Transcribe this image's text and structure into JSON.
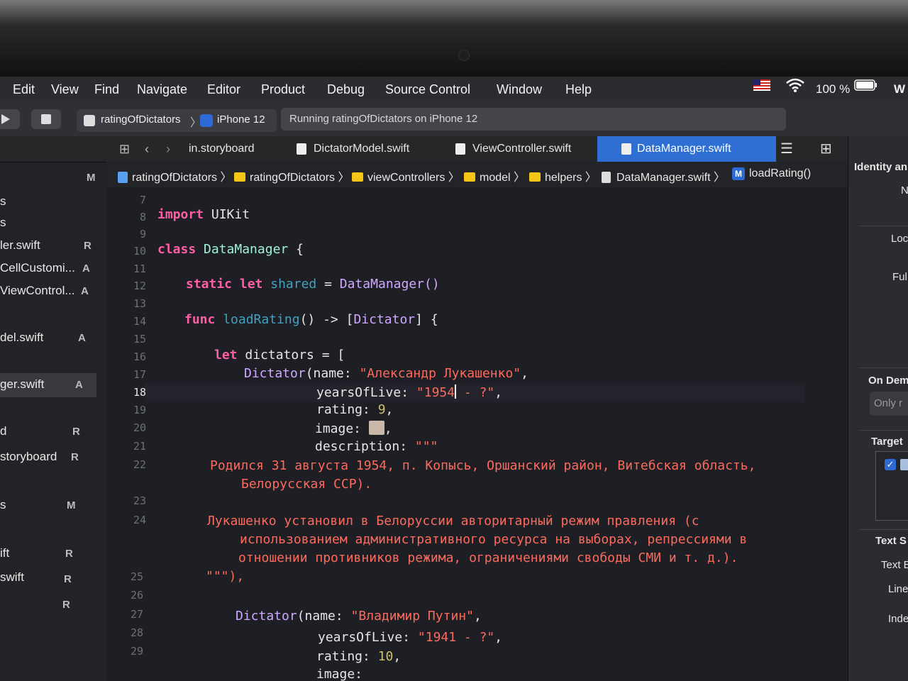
{
  "menu": {
    "items": [
      "Edit",
      "View",
      "Find",
      "Navigate",
      "Editor",
      "Product",
      "Debug",
      "Source Control",
      "Window",
      "Help"
    ],
    "battery": "100 %",
    "trailing": "W"
  },
  "toolbar": {
    "scheme": "ratingOfDictators",
    "device": "iPhone 12",
    "activity": "Running ratingOfDictators on iPhone 12"
  },
  "tabs": [
    "in.storyboard",
    "DictatorModel.swift",
    "ViewController.swift",
    "DataManager.swift"
  ],
  "breadcrumb": [
    "ratingOfDictators",
    "ratingOfDictators",
    "viewControllers",
    "model",
    "helpers",
    "DataManager.swift",
    "loadRating()"
  ],
  "navigator": {
    "header_badge": "M",
    "items": [
      {
        "label": "s",
        "badge": ""
      },
      {
        "label": "s",
        "badge": ""
      },
      {
        "label": "ler.swift",
        "badge": "R"
      },
      {
        "label": "CellCustomi...",
        "badge": "A"
      },
      {
        "label": "ViewControl...",
        "badge": "A"
      },
      {
        "label": "del.swift",
        "badge": "A"
      },
      {
        "label": "ger.swift",
        "badge": "A"
      },
      {
        "label": "d",
        "badge": "R"
      },
      {
        "label": "storyboard",
        "badge": "R"
      },
      {
        "label": "s",
        "badge": "M"
      },
      {
        "label": "ift",
        "badge": "R"
      },
      {
        "label": "swift",
        "badge": "R"
      },
      {
        "label": "",
        "badge": "R"
      }
    ]
  },
  "code": {
    "line_numbers": [
      "7",
      "8",
      "9",
      "10",
      "11",
      "12",
      "13",
      "14",
      "15",
      "16",
      "17",
      "18",
      "19",
      "20",
      "21",
      "22",
      "23",
      "24",
      "25",
      "26",
      "27",
      "28",
      "29"
    ],
    "tokens": {
      "import": "import",
      "uikit": "UIKit",
      "class": "class",
      "datamanager": "DataManager",
      "brace": "{",
      "static": "static",
      "let": "let",
      "shared": "shared",
      "eq": "=",
      "init": "DataManager()",
      "func": "func",
      "loadrating": "loadRating",
      "sig": "() -> [",
      "dictator": "Dictator",
      "sig_end": "] {",
      "dictators": "dictators",
      "eqbracket": "= [",
      "dictator_call": "Dictator",
      "name_label": "(name: ",
      "name1": "\"Александр Лукашенко\"",
      "comma": ",",
      "years_label": "yearsOfLive: ",
      "years1_a": "\"1954",
      "years1_b": " - ?\"",
      "rating_label": "rating: ",
      "rating1": "9",
      "image_label": "image: ",
      "desc_label": "description: ",
      "triple": "\"\"\"",
      "d1": "Родился 31 августа 1954, п. Копысь, Оршанский район, Витебская область,",
      "d2": "Белорусская ССР).",
      "d3": "Лукашенко установил в Белоруссии авторитарный режим правления (с",
      "d4": "использованием административного ресурса на выборах, репрессиями в",
      "d5": "отношении противников режима, ограничениями свободы СМИ и т. д.).",
      "d6_end": "\"\"\"),",
      "name2": "\"Владимир Путин\"",
      "years2": "\"1941 - ?\"",
      "rating2": "10",
      "image_partial": "image:"
    }
  },
  "inspector": {
    "title": "Identity an",
    "n": "N",
    "loc": "Loc",
    "ful": "Ful",
    "on_demand": "On Dem",
    "only": "Only r",
    "target": "Target",
    "text_s": "Text S",
    "text_e": "Text E",
    "line": "Line",
    "inde": "Inde"
  }
}
